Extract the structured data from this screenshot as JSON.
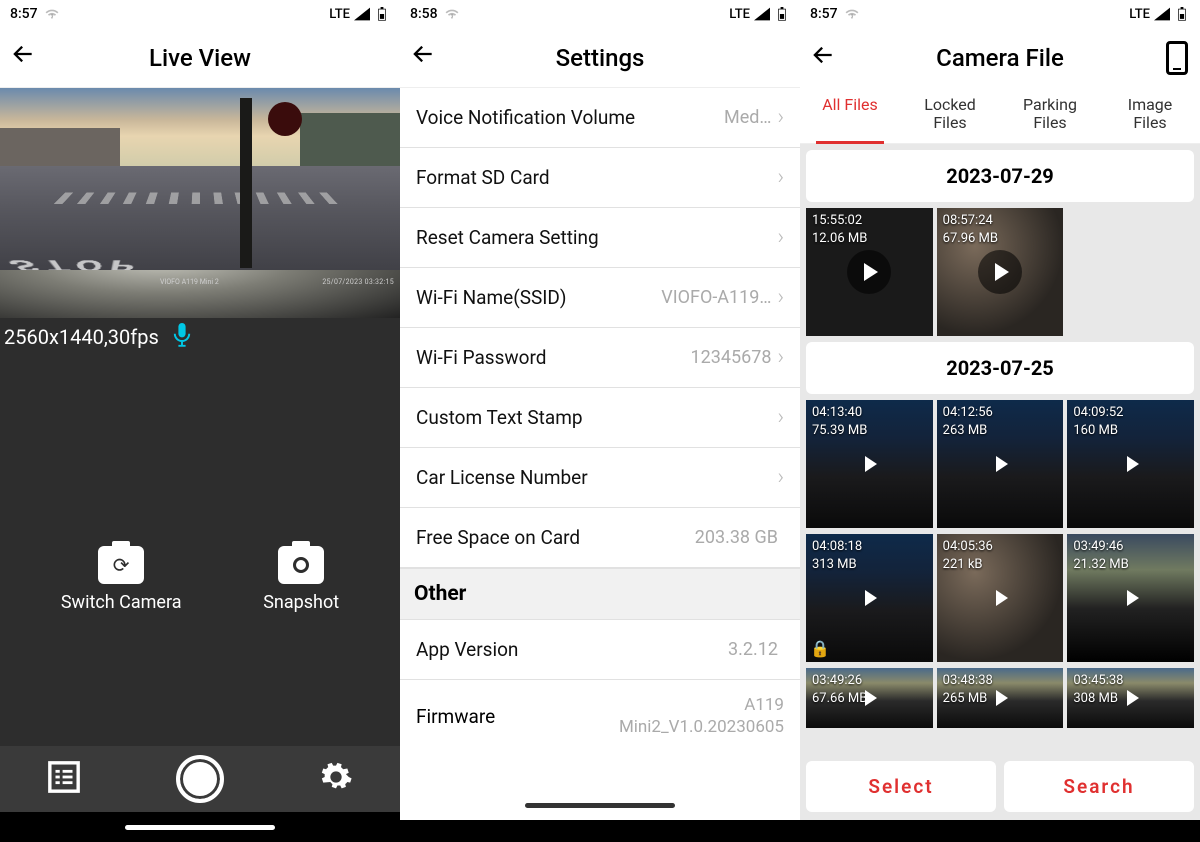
{
  "status": {
    "time_a": "8:57",
    "time_b": "8:58",
    "net": "LTE"
  },
  "live": {
    "title": "Live View",
    "resolution": "2560x1440,30fps",
    "stop_road": "STOP",
    "overlay_right": "25/07/2023 03:32:15",
    "overlay_left": "VIOFO A119 Mini 2",
    "switch_label": "Switch Camera",
    "snapshot_label": "Snapshot"
  },
  "settings": {
    "title": "Settings",
    "rows": [
      {
        "label": "Voice Notification Volume",
        "value": "Med…",
        "chevron": true
      },
      {
        "label": "Format SD Card",
        "value": "",
        "chevron": true
      },
      {
        "label": "Reset Camera Setting",
        "value": "",
        "chevron": true
      },
      {
        "label": "Wi-Fi Name(SSID)",
        "value": "VIOFO-A119…",
        "chevron": true
      },
      {
        "label": "Wi-Fi Password",
        "value": "12345678",
        "chevron": true
      },
      {
        "label": "Custom Text Stamp",
        "value": "",
        "chevron": true
      },
      {
        "label": "Car License Number",
        "value": "",
        "chevron": true
      },
      {
        "label": "Free Space on Card",
        "value": "203.38 GB",
        "chevron": false
      }
    ],
    "section": "Other",
    "app_version_label": "App Version",
    "app_version_value": "3.2.12",
    "firmware_label": "Firmware",
    "firmware_value_1": "A119",
    "firmware_value_2": "Mini2_V1.0.20230605"
  },
  "files": {
    "title": "Camera File",
    "tabs": [
      "All Files",
      "Locked\nFiles",
      "Parking\nFiles",
      "Image\nFiles"
    ],
    "active_tab": 0,
    "date1": "2023-07-29",
    "group1": [
      {
        "time": "15:55:02",
        "size": "12.06 MB",
        "style": "th-dark",
        "big": true
      },
      {
        "time": "08:57:24",
        "size": "67.96 MB",
        "style": "th-blur",
        "big": true
      }
    ],
    "date2": "2023-07-25",
    "group2a": [
      {
        "time": "04:13:40",
        "size": "75.39 MB",
        "style": "th-street"
      },
      {
        "time": "04:12:56",
        "size": "263 MB",
        "style": "th-street"
      },
      {
        "time": "04:09:52",
        "size": "160 MB",
        "style": "th-street"
      }
    ],
    "group2b": [
      {
        "time": "04:08:18",
        "size": "313 MB",
        "style": "th-street",
        "locked": true
      },
      {
        "time": "04:05:36",
        "size": "221 kB",
        "style": "th-blur"
      },
      {
        "time": "03:49:46",
        "size": "21.32 MB",
        "style": "th-dusky"
      }
    ],
    "group2c": [
      {
        "time": "03:49:26",
        "size": "67.66 MB",
        "style": "th-twilight"
      },
      {
        "time": "03:48:38",
        "size": "265 MB",
        "style": "th-twilight"
      },
      {
        "time": "03:45:38",
        "size": "308 MB",
        "style": "th-twilight"
      }
    ],
    "select_label": "Select",
    "search_label": "Search"
  }
}
